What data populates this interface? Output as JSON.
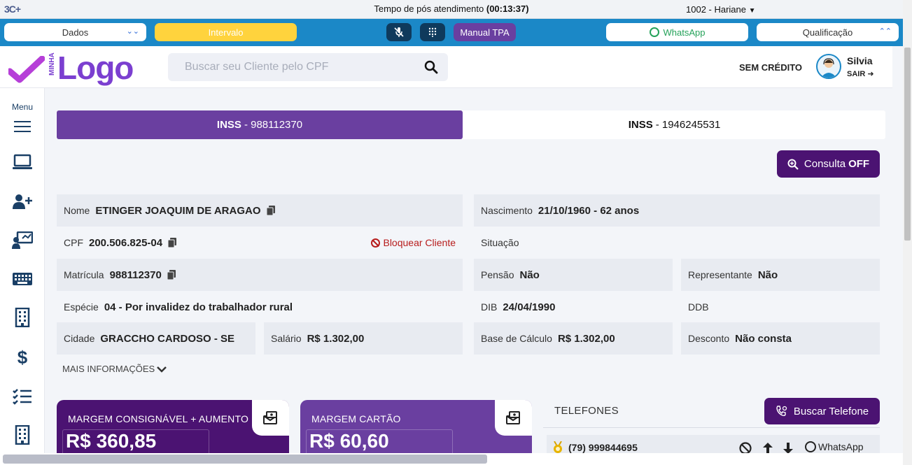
{
  "status_bar": {
    "logo": "3C+",
    "timer_label": "Tempo de pós atendimento",
    "timer_value": "(00:13:37)",
    "agent": "1002 - Hariane"
  },
  "action_bar": {
    "dados": "Dados",
    "intervalo": "Intervalo",
    "manual_tpa": "Manual TPA",
    "whatsapp": "WhatsApp",
    "qualificacao": "Qualificação"
  },
  "header": {
    "brand_small": "MINHA",
    "brand_word": "Logo",
    "search_placeholder": "Buscar seu Cliente pelo CPF",
    "credit": "SEM CRÉDITO",
    "user_name": "Silvia",
    "logout": "SAIR"
  },
  "sidebar": {
    "menu_label": "Menu"
  },
  "tabs": [
    {
      "label": "INSS",
      "value": "- 988112370"
    },
    {
      "label": "INSS",
      "value": "- 1946245531"
    }
  ],
  "consulta_button": {
    "label": "Consulta",
    "state": "OFF"
  },
  "client": {
    "nome_label": "Nome",
    "nome": "ETINGER JOAQUIM DE ARAGAO",
    "nascimento_label": "Nascimento",
    "nascimento": "21/10/1960 - 62 anos",
    "cpf_label": "CPF",
    "cpf": "200.506.825-04",
    "bloquear": "Bloquear Cliente",
    "situacao_label": "Situação",
    "situacao": "",
    "matricula_label": "Matrícula",
    "matricula": "988112370",
    "pensao_label": "Pensão",
    "pensao": "Não",
    "representante_label": "Representante",
    "representante": "Não",
    "especie_label": "Espécie",
    "especie": "04 - Por invalidez do trabalhador rural",
    "dib_label": "DIB",
    "dib": "24/04/1990",
    "ddb_label": "DDB",
    "ddb": "",
    "cidade_label": "Cidade",
    "cidade": "GRACCHO CARDOSO - SE",
    "salario_label": "Salário",
    "salario": "R$ 1.302,00",
    "base_label": "Base de Cálculo",
    "base": "R$ 1.302,00",
    "desconto_label": "Desconto",
    "desconto": "Não consta",
    "mais_info": "MAIS INFORMAÇÕES"
  },
  "cards": [
    {
      "title": "MARGEM CONSIGNÁVEL + AUMENTO",
      "amount": "R$ 360,85"
    },
    {
      "title": "MARGEM CARTÃO",
      "amount": "R$ 60,60"
    }
  ],
  "phones": {
    "title": "TELEFONES",
    "search_button": "Buscar Telefone",
    "rows": [
      {
        "number": "(79) 999844695",
        "whatsapp_label": "WhatsApp"
      }
    ]
  },
  "colors": {
    "primary_purple": "#6a3fa0",
    "dark_purple": "#4b1372",
    "action_blue": "#1b88c7",
    "break_yellow": "#ffd33d",
    "block_red": "#b71c1c",
    "whatsapp_green": "#25a25a"
  }
}
